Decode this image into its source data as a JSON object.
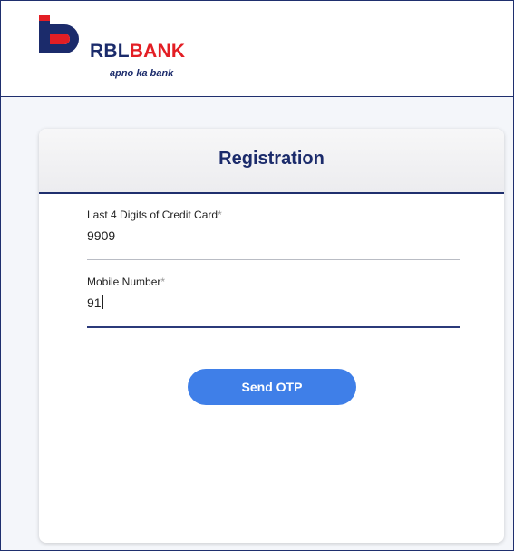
{
  "header": {
    "brand_rbl": "RBL",
    "brand_bank": "BANK",
    "tagline": "apno ka bank"
  },
  "registration": {
    "title": "Registration",
    "card_field": {
      "label": "Last 4 Digits of Credit Card",
      "required_mark": "*",
      "value": "9909"
    },
    "mobile_field": {
      "label": "Mobile Number",
      "required_mark": "*",
      "value": "91"
    },
    "send_otp_label": "Send OTP"
  },
  "colors": {
    "brand_navy": "#1b2b6b",
    "brand_red": "#e31e24",
    "button_blue": "#3f7fe8"
  }
}
